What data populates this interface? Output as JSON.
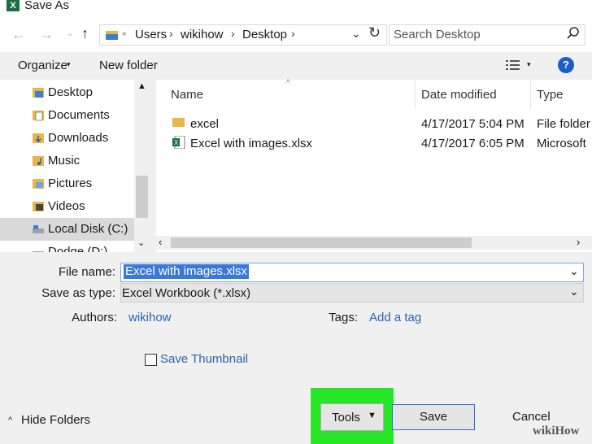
{
  "window": {
    "title": "Save As",
    "app_icon": "X"
  },
  "nav": {
    "breadcrumbs": [
      "Users",
      "wikihow",
      "Desktop"
    ],
    "search_placeholder": "Search Desktop"
  },
  "toolbar": {
    "organize_label": "Organize",
    "new_folder_label": "New folder",
    "help_label": "?"
  },
  "sidebar": {
    "items": [
      {
        "label": "Desktop"
      },
      {
        "label": "Documents"
      },
      {
        "label": "Downloads"
      },
      {
        "label": "Music"
      },
      {
        "label": "Pictures"
      },
      {
        "label": "Videos"
      },
      {
        "label": "Local Disk (C:)"
      },
      {
        "label": "Dodge (D:)"
      }
    ]
  },
  "files": {
    "columns": [
      "Name",
      "Date modified",
      "Type"
    ],
    "rows": [
      {
        "name": "excel",
        "date": "4/17/2017 5:04 PM",
        "type": "File folder"
      },
      {
        "name": "Excel with images.xlsx",
        "date": "4/17/2017 6:05 PM",
        "type": "Microsoft"
      }
    ]
  },
  "form": {
    "file_name_label": "File name:",
    "file_name_value": "Excel with images.xlsx",
    "save_type_label": "Save as type:",
    "save_type_value": "Excel Workbook (*.xlsx)",
    "authors_label": "Authors:",
    "authors_value": "wikihow",
    "tags_label": "Tags:",
    "tags_value": "Add a tag",
    "thumbnail_label": "Save Thumbnail"
  },
  "footer": {
    "hide_folders_label": "Hide Folders",
    "tools_label": "Tools",
    "save_label": "Save",
    "cancel_label": "Cancel",
    "watermark": "wikiHow"
  },
  "colors": {
    "accent": "#2b6fd8",
    "highlight": "#27e627",
    "selection": "#3b78d8"
  }
}
